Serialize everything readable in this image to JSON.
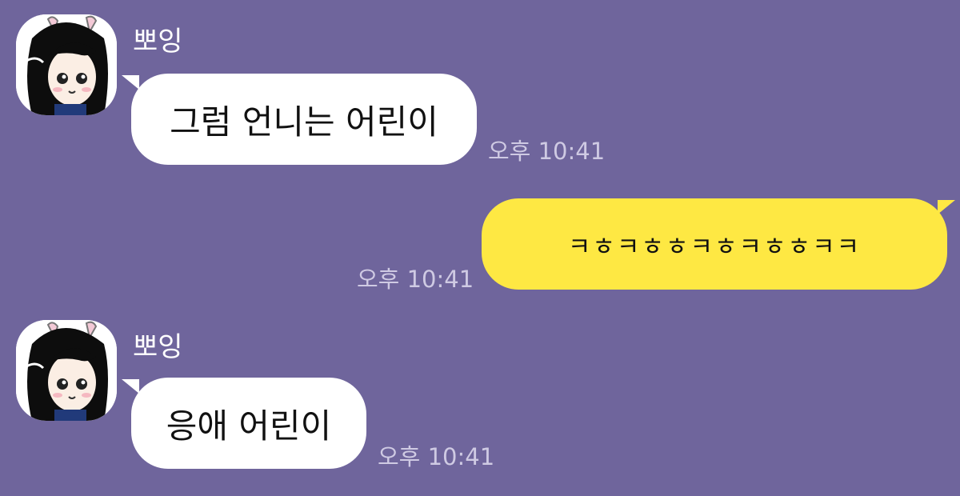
{
  "messages": [
    {
      "direction": "incoming",
      "sender": "뽀잉",
      "text": "그럼 언니는 어린이",
      "time": "오후 10:41"
    },
    {
      "direction": "outgoing",
      "text": "ㅋㅎㅋㅎㅎㅋㅎㅋㅎㅎㅋㅋ",
      "time": "오후 10:41"
    },
    {
      "direction": "incoming",
      "sender": "뽀잉",
      "text": "응애 어린이",
      "time": "오후 10:41"
    }
  ],
  "colors": {
    "background": "#6f659c",
    "incoming_bubble": "#ffffff",
    "outgoing_bubble": "#fee843",
    "timestamp": "#cfcae3"
  }
}
